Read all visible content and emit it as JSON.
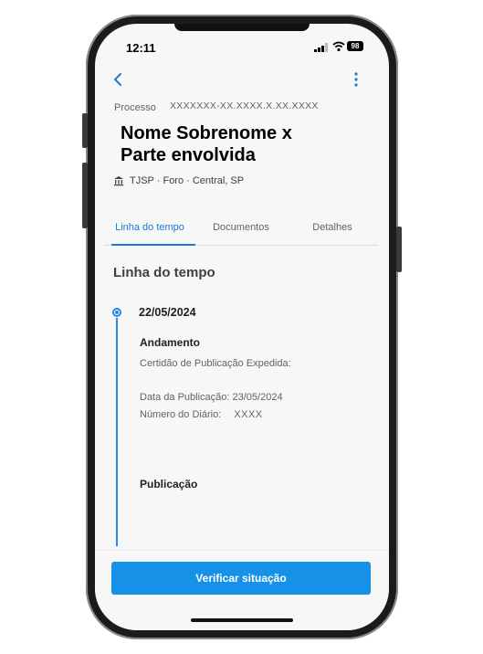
{
  "status": {
    "time": "12:11",
    "battery": "98"
  },
  "header": {
    "process_label": "Processo",
    "process_number": "XXXXXXX-XX.XXXX.X.XX.XXXX",
    "title": "Nome Sobrenome x Parte envolvida",
    "court": "TJSP · Foro · Central, SP"
  },
  "tabs": [
    {
      "label": "Linha do tempo"
    },
    {
      "label": "Documentos"
    },
    {
      "label": "Detalhes"
    }
  ],
  "timeline": {
    "section_title": "Linha do tempo",
    "entry": {
      "date": "22/05/2024",
      "andamento_title": "Andamento",
      "line1": "Certidão de Publicação Expedida:",
      "line2": "Data da Publicação: 23/05/2024",
      "line3_label": "Número do Diário:",
      "line3_value": "XXXX",
      "publicacao_title": "Publicação"
    }
  },
  "cta": {
    "label": "Verificar situação"
  },
  "colors": {
    "accent": "#1592e8",
    "tab_active": "#1a7ad6"
  },
  "icons": [
    "back-chevron-icon",
    "more-vertical-icon",
    "courthouse-icon",
    "signal-icon",
    "wifi-icon",
    "battery-icon"
  ]
}
